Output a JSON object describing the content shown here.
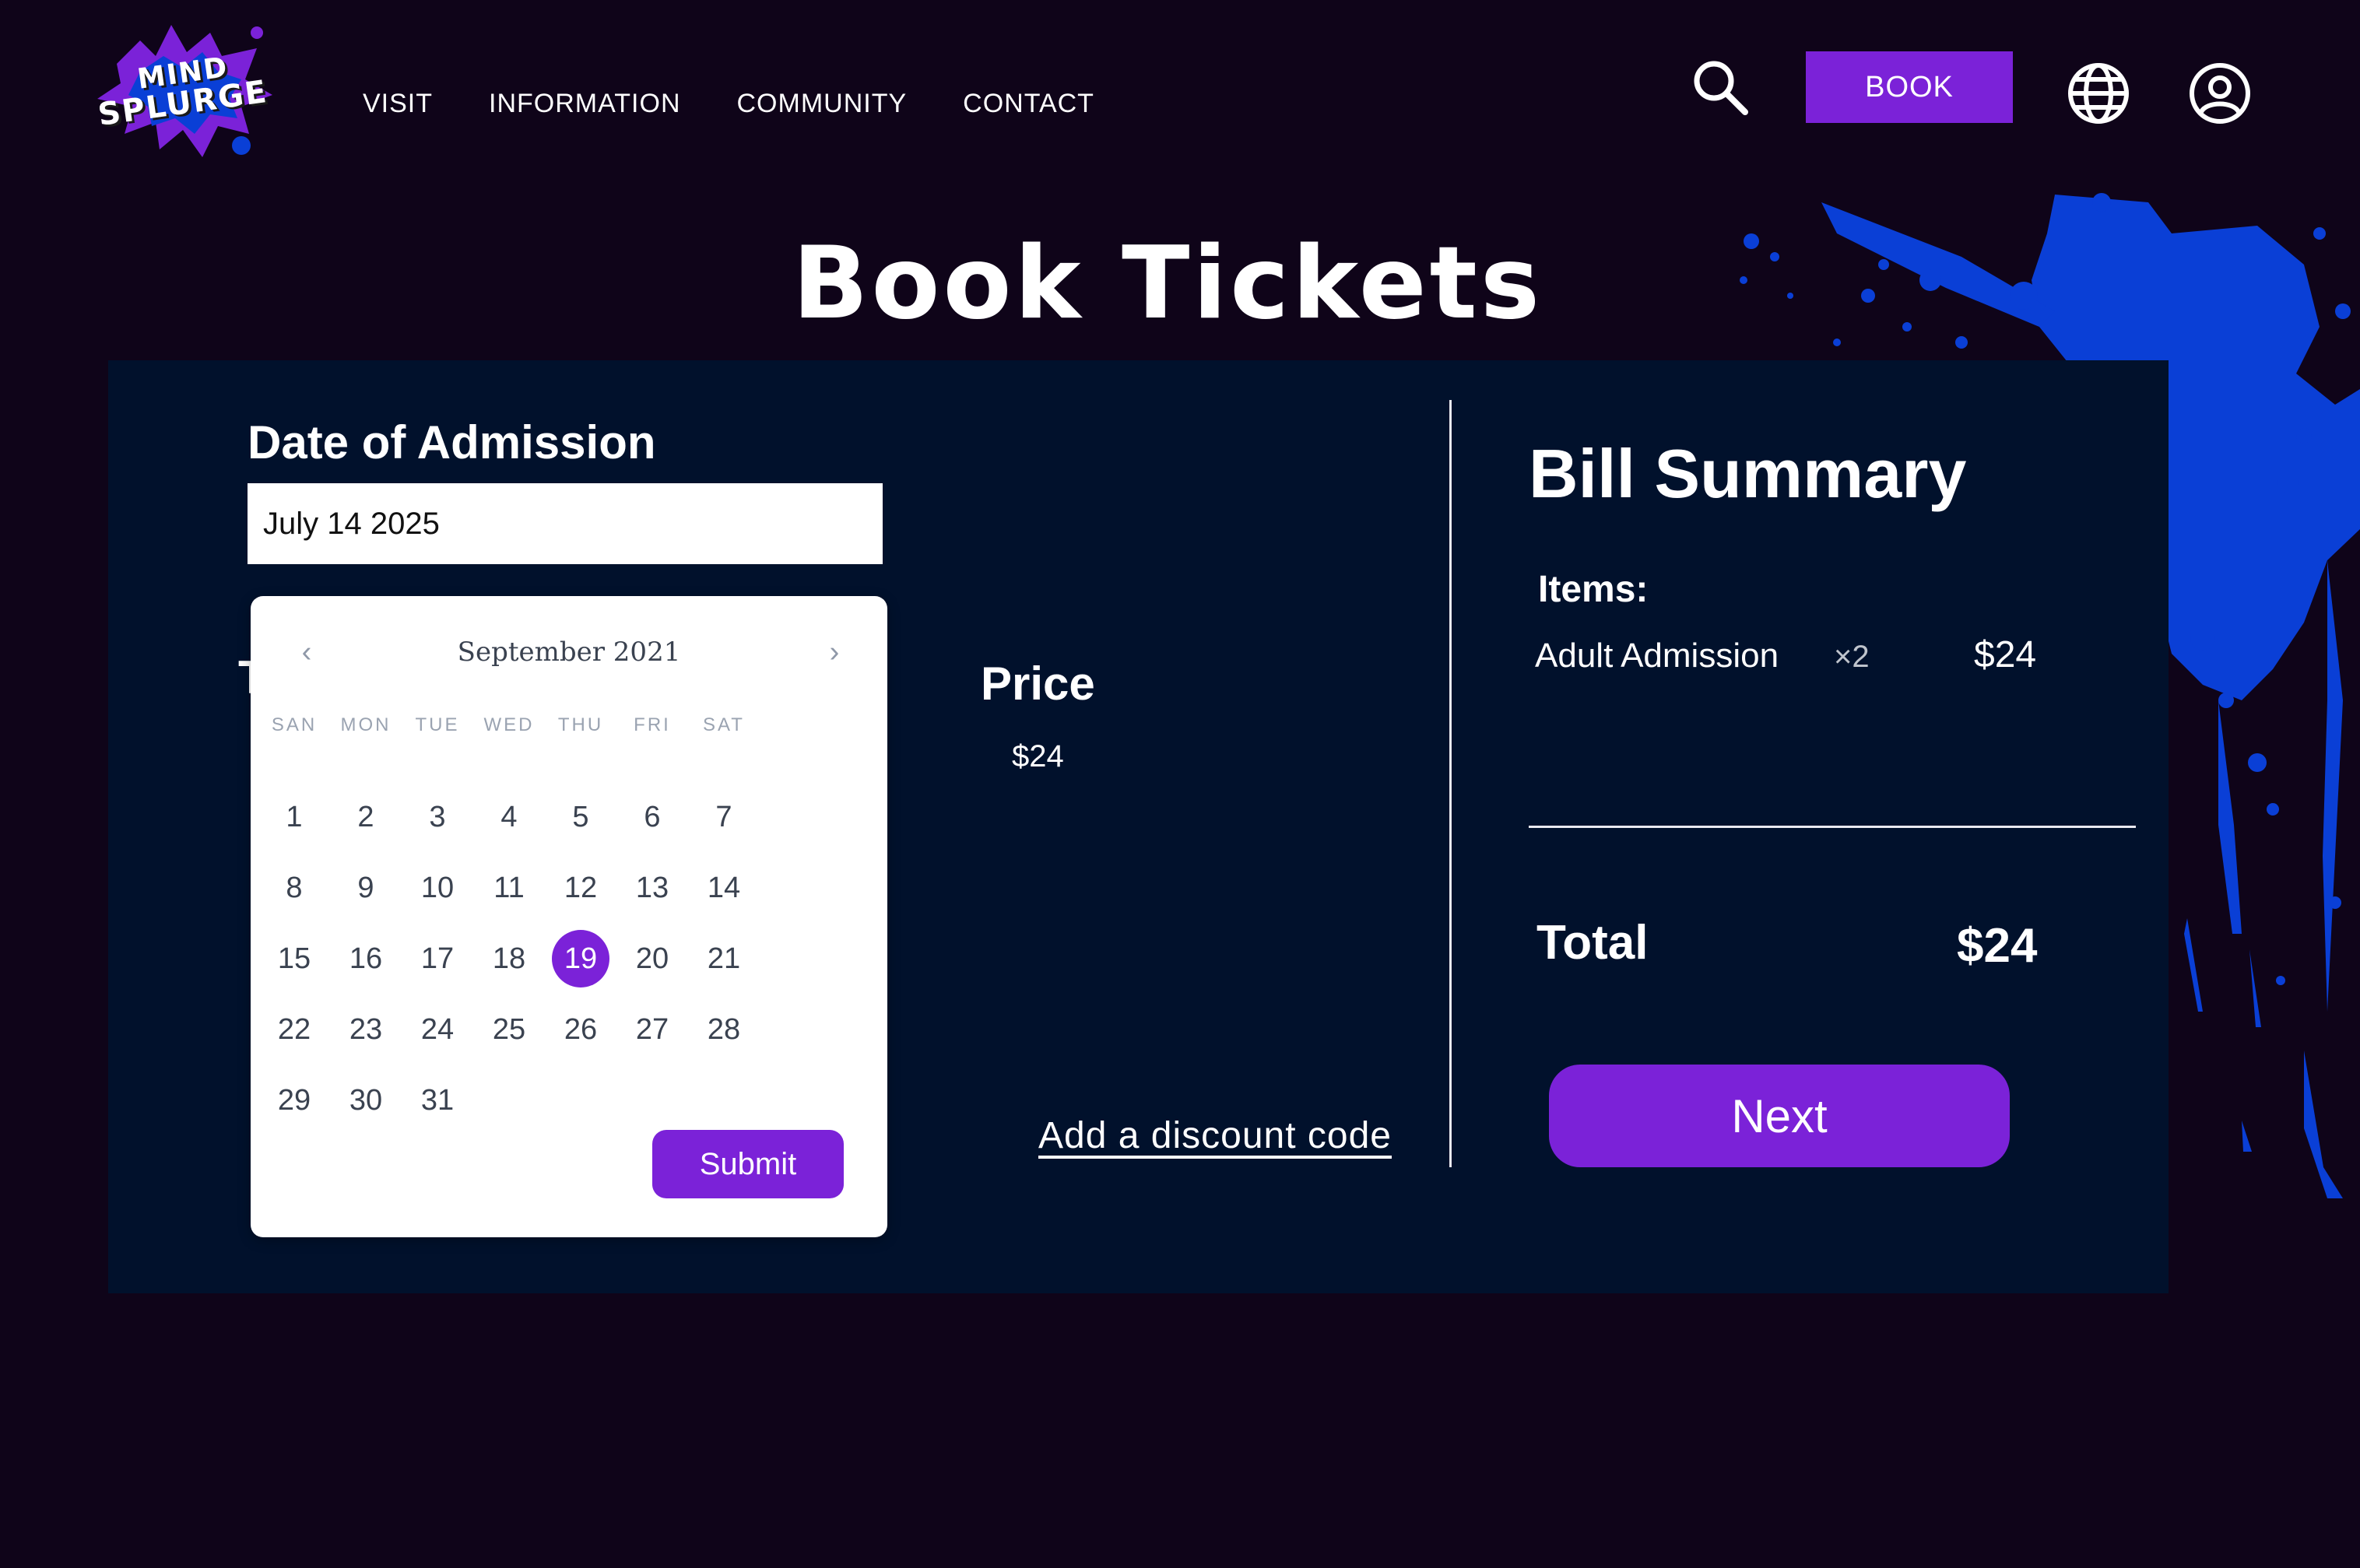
{
  "brand": {
    "logo_line1": "MIND",
    "logo_line2": "SPLURGE"
  },
  "nav": {
    "items": [
      "VISIT",
      "INFORMATION",
      "COMMUNITY",
      "CONTACT"
    ]
  },
  "header": {
    "book_label": "BOOK"
  },
  "icons": {
    "search": "search-icon",
    "globe": "globe-icon",
    "account": "user-icon"
  },
  "page": {
    "title": "Book Tickets"
  },
  "booking": {
    "date_label": "Date of Admission",
    "date_value": "July 14 2025",
    "partial_heading": "T",
    "price_label": "Price",
    "price_value": "$24",
    "discount_link": "Add a discount code"
  },
  "calendar": {
    "month": "September 2021",
    "weekdays": [
      "SAN",
      "MON",
      "TUE",
      "WED",
      "THU",
      "FRI",
      "SAT"
    ],
    "days": [
      1,
      2,
      3,
      4,
      5,
      6,
      7,
      8,
      9,
      10,
      11,
      12,
      13,
      14,
      15,
      16,
      17,
      18,
      19,
      20,
      21,
      22,
      23,
      24,
      25,
      26,
      27,
      28,
      29,
      30,
      31
    ],
    "selected_day": 19,
    "prev": "‹",
    "next": "›",
    "submit_label": "Submit"
  },
  "bill": {
    "title": "Bill Summary",
    "items_label": "Items:",
    "items": [
      {
        "name": "Adult Admission",
        "qty": "×2",
        "price": "$24"
      }
    ],
    "total_label": "Total",
    "total_value": "$24",
    "next_label": "Next"
  },
  "colors": {
    "background": "#0f0419",
    "panel": "#01112c",
    "accent": "#7b22d8",
    "splatter": "#0a3fd6"
  }
}
